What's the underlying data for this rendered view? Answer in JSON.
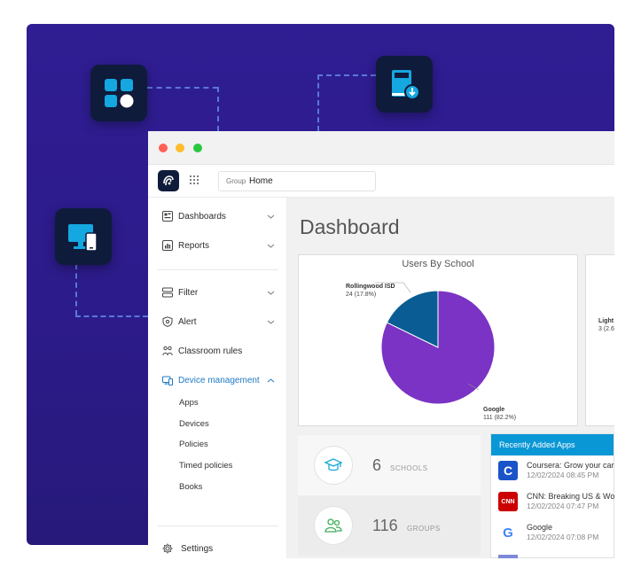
{
  "header": {
    "group_label": "Group",
    "group_value": "Home"
  },
  "sidebar": {
    "items": [
      {
        "label": "Dashboards"
      },
      {
        "label": "Reports"
      },
      {
        "label": "Filter"
      },
      {
        "label": "Alert"
      },
      {
        "label": "Classroom rules"
      },
      {
        "label": "Device management"
      }
    ],
    "device_management_sub": [
      "Apps",
      "Devices",
      "Policies",
      "Timed policies",
      "Books"
    ],
    "settings_label": "Settings"
  },
  "main": {
    "title": "Dashboard",
    "users_by_school": {
      "title": "Users By School",
      "slices": [
        {
          "name": "Rollingwood ISD",
          "detail": "24 (17.8%)",
          "value": 24,
          "color": "#0a5d94"
        },
        {
          "name": "Google",
          "detail": "111 (82.2%)",
          "value": 111,
          "color": "#7a33c4"
        }
      ]
    },
    "second_card": {
      "label_fragment": "Light",
      "detail_fragment": "3 (2.6"
    },
    "stats": [
      {
        "value": "6",
        "label": "SCHOOLS",
        "icon": "graduation-cap-icon"
      },
      {
        "value": "116",
        "label": "GROUPS",
        "icon": "users-icon"
      }
    ],
    "recently_added_apps": {
      "title": "Recently Added Apps",
      "items": [
        {
          "name": "Coursera: Grow your care",
          "date": "12/02/2024 08:45 PM",
          "icon": "coursera-icon"
        },
        {
          "name": "CNN: Breaking US & Worl",
          "date": "12/02/2024 07:47 PM",
          "icon": "cnn-icon"
        },
        {
          "name": "Google",
          "date": "12/02/2024 07:08 PM",
          "icon": "google-icon"
        }
      ]
    }
  },
  "colors": {
    "background_panel": "#2f1d93",
    "accent": "#1f7bc4",
    "apps_header": "#0a97d6",
    "dot_red": "#ff5f57",
    "dot_yellow": "#febc2e",
    "dot_green": "#28c840"
  }
}
